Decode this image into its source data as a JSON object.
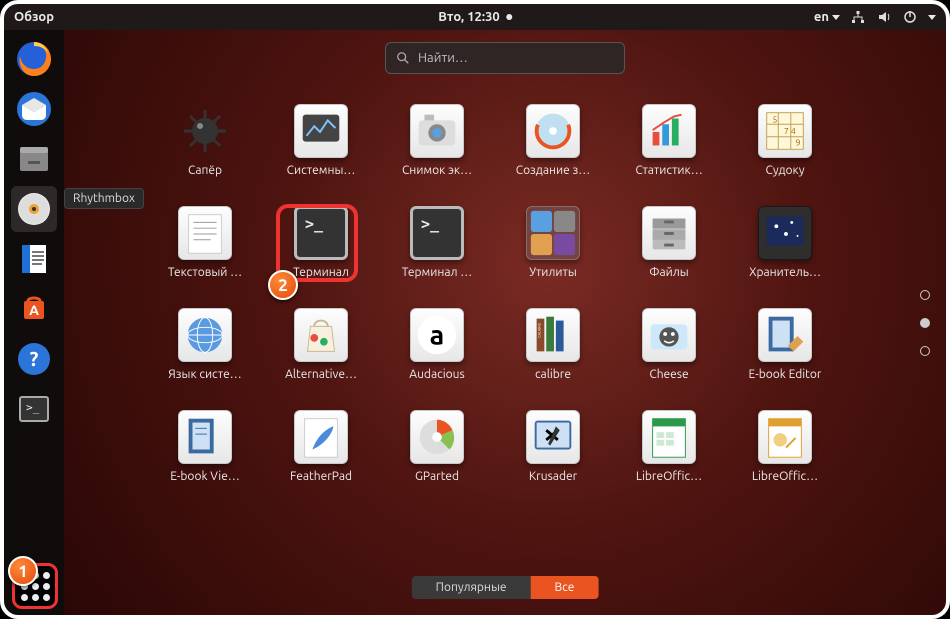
{
  "topbar": {
    "activities": "Обзор",
    "clock": "Вто, 12:30",
    "lang": "en"
  },
  "tooltip": {
    "rhythmbox": "Rhythmbox"
  },
  "search": {
    "placeholder": "Найти…"
  },
  "dock": {
    "items": [
      {
        "name": "firefox"
      },
      {
        "name": "thunderbird"
      },
      {
        "name": "files"
      },
      {
        "name": "rhythmbox"
      },
      {
        "name": "libreoffice-writer"
      },
      {
        "name": "software"
      },
      {
        "name": "help"
      },
      {
        "name": "terminal"
      }
    ]
  },
  "apps": [
    {
      "label": "Сапёр",
      "icon": "mine"
    },
    {
      "label": "Системны…",
      "icon": "monitor"
    },
    {
      "label": "Снимок эк…",
      "icon": "camera"
    },
    {
      "label": "Создание з…",
      "icon": "disk"
    },
    {
      "label": "Статистик…",
      "icon": "chart"
    },
    {
      "label": "Судоку",
      "icon": "sudoku"
    },
    {
      "label": "Текстовый …",
      "icon": "editor"
    },
    {
      "label": "Терминал",
      "icon": "terminal",
      "highlight": true
    },
    {
      "label": "Терминал …",
      "icon": "terminal"
    },
    {
      "label": "Утилиты",
      "icon": "folder",
      "folder": true
    },
    {
      "label": "Файлы",
      "icon": "drawer"
    },
    {
      "label": "Хранитель…",
      "icon": "screensaver"
    },
    {
      "label": "Язык систе…",
      "icon": "lang"
    },
    {
      "label": "Alternative…",
      "icon": "bag"
    },
    {
      "label": "Audacious",
      "icon": "audacious"
    },
    {
      "label": "calibre",
      "icon": "books"
    },
    {
      "label": "Cheese",
      "icon": "cheese"
    },
    {
      "label": "E-book Editor",
      "icon": "ebookedit"
    },
    {
      "label": "E-book Vie…",
      "icon": "ebookview"
    },
    {
      "label": "FeatherPad",
      "icon": "feather"
    },
    {
      "label": "GParted",
      "icon": "gparted"
    },
    {
      "label": "Krusader",
      "icon": "krusader"
    },
    {
      "label": "LibreOffic…",
      "icon": "lo-calc"
    },
    {
      "label": "LibreOffic…",
      "icon": "lo-draw"
    }
  ],
  "pager": {
    "count": 3,
    "active": 1
  },
  "tabs": {
    "frequent": "Популярные",
    "all": "Все",
    "active": "all"
  },
  "annotations": {
    "badge1": "1",
    "badge2": "2"
  }
}
